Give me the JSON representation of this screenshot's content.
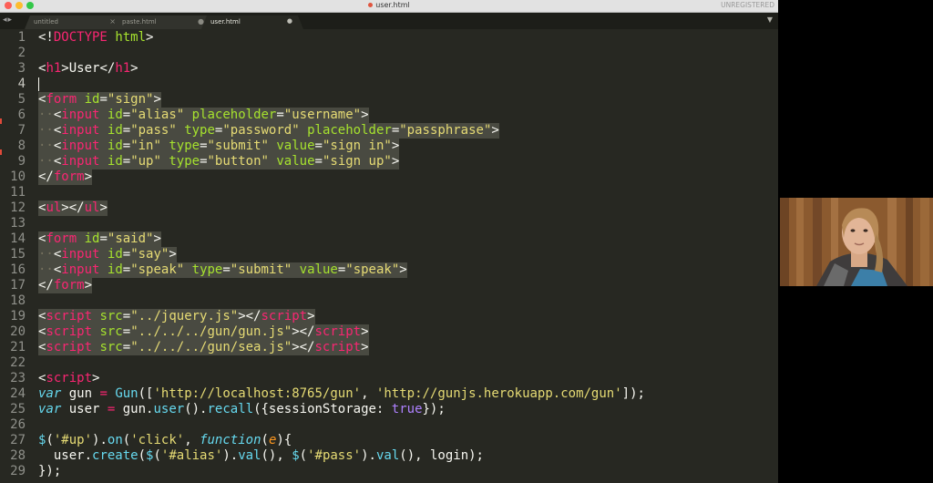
{
  "window": {
    "title": "user.html",
    "unregistered": "UNREGISTERED",
    "dirty_dot_color": "#e0553f"
  },
  "tabs": [
    {
      "label": "untitled",
      "close": "×",
      "active": false
    },
    {
      "label": "paste.html",
      "close": "●",
      "active": false
    },
    {
      "label": "user.html",
      "close": "●",
      "active": true
    }
  ],
  "tab_nav_icons": [
    "chevron-left-icon",
    "chevron-right-icon"
  ],
  "theme": {
    "background": "#272822",
    "tag": "#f92672",
    "attr": "#a6e22e",
    "string": "#e6db74",
    "keyword": "#66d9ef",
    "constant": "#ae81ff",
    "param": "#fd971f"
  },
  "editor": {
    "cursor_line": 4,
    "lines": [
      {
        "n": "1",
        "tokens": [
          {
            "c": "p",
            "t": "<!"
          },
          {
            "c": "t",
            "t": "DOCTYPE"
          },
          {
            "c": "p",
            "t": " "
          },
          {
            "c": "a",
            "t": "html"
          },
          {
            "c": "p",
            "t": ">"
          }
        ]
      },
      {
        "n": "2",
        "tokens": []
      },
      {
        "n": "3",
        "tokens": [
          {
            "c": "p",
            "t": "<"
          },
          {
            "c": "t",
            "t": "h1"
          },
          {
            "c": "p",
            "t": ">User</"
          },
          {
            "c": "t",
            "t": "h1"
          },
          {
            "c": "p",
            "t": ">"
          }
        ]
      },
      {
        "n": "4",
        "tokens": []
      },
      {
        "n": "5",
        "tokens": [
          {
            "c": "p",
            "t": "<"
          },
          {
            "c": "t",
            "t": "form"
          },
          {
            "c": "p",
            "t": " "
          },
          {
            "c": "a",
            "t": "id"
          },
          {
            "c": "p",
            "t": "="
          },
          {
            "c": "s",
            "t": "\"sign\""
          },
          {
            "c": "p",
            "t": ">"
          }
        ]
      },
      {
        "n": "6",
        "tokens": [
          {
            "c": "d",
            "t": "··"
          },
          {
            "c": "p",
            "t": "<"
          },
          {
            "c": "t",
            "t": "input"
          },
          {
            "c": "p",
            "t": " "
          },
          {
            "c": "a",
            "t": "id"
          },
          {
            "c": "p",
            "t": "="
          },
          {
            "c": "s",
            "t": "\"alias\""
          },
          {
            "c": "p",
            "t": " "
          },
          {
            "c": "a",
            "t": "placeholder"
          },
          {
            "c": "p",
            "t": "="
          },
          {
            "c": "s",
            "t": "\"username\""
          },
          {
            "c": "p",
            "t": ">"
          }
        ]
      },
      {
        "n": "7",
        "tokens": [
          {
            "c": "d",
            "t": "··"
          },
          {
            "c": "p",
            "t": "<"
          },
          {
            "c": "t",
            "t": "input"
          },
          {
            "c": "p",
            "t": " "
          },
          {
            "c": "a",
            "t": "id"
          },
          {
            "c": "p",
            "t": "="
          },
          {
            "c": "s",
            "t": "\"pass\""
          },
          {
            "c": "p",
            "t": " "
          },
          {
            "c": "a",
            "t": "type"
          },
          {
            "c": "p",
            "t": "="
          },
          {
            "c": "s",
            "t": "\"password\""
          },
          {
            "c": "p",
            "t": " "
          },
          {
            "c": "a",
            "t": "placeholder"
          },
          {
            "c": "p",
            "t": "="
          },
          {
            "c": "s",
            "t": "\"passphrase\""
          },
          {
            "c": "p",
            "t": ">"
          }
        ]
      },
      {
        "n": "8",
        "tokens": [
          {
            "c": "d",
            "t": "··"
          },
          {
            "c": "p",
            "t": "<"
          },
          {
            "c": "t",
            "t": "input"
          },
          {
            "c": "p",
            "t": " "
          },
          {
            "c": "a",
            "t": "id"
          },
          {
            "c": "p",
            "t": "="
          },
          {
            "c": "s",
            "t": "\"in\""
          },
          {
            "c": "p",
            "t": " "
          },
          {
            "c": "a",
            "t": "type"
          },
          {
            "c": "p",
            "t": "="
          },
          {
            "c": "s",
            "t": "\"submit\""
          },
          {
            "c": "p",
            "t": " "
          },
          {
            "c": "a",
            "t": "value"
          },
          {
            "c": "p",
            "t": "="
          },
          {
            "c": "s",
            "t": "\"sign in\""
          },
          {
            "c": "p",
            "t": ">"
          }
        ]
      },
      {
        "n": "9",
        "tokens": [
          {
            "c": "d",
            "t": "··"
          },
          {
            "c": "p",
            "t": "<"
          },
          {
            "c": "t",
            "t": "input"
          },
          {
            "c": "p",
            "t": " "
          },
          {
            "c": "a",
            "t": "id"
          },
          {
            "c": "p",
            "t": "="
          },
          {
            "c": "s",
            "t": "\"up\""
          },
          {
            "c": "p",
            "t": " "
          },
          {
            "c": "a",
            "t": "type"
          },
          {
            "c": "p",
            "t": "="
          },
          {
            "c": "s",
            "t": "\"button\""
          },
          {
            "c": "p",
            "t": " "
          },
          {
            "c": "a",
            "t": "value"
          },
          {
            "c": "p",
            "t": "="
          },
          {
            "c": "s",
            "t": "\"sign up\""
          },
          {
            "c": "p",
            "t": ">"
          }
        ]
      },
      {
        "n": "10",
        "tokens": [
          {
            "c": "p",
            "t": "</"
          },
          {
            "c": "t",
            "t": "form"
          },
          {
            "c": "p",
            "t": ">"
          }
        ]
      },
      {
        "n": "11",
        "tokens": []
      },
      {
        "n": "12",
        "tokens": [
          {
            "c": "p",
            "t": "<"
          },
          {
            "c": "t",
            "t": "ul"
          },
          {
            "c": "p",
            "t": "></"
          },
          {
            "c": "t",
            "t": "ul"
          },
          {
            "c": "p",
            "t": ">"
          }
        ]
      },
      {
        "n": "13",
        "tokens": []
      },
      {
        "n": "14",
        "tokens": [
          {
            "c": "p",
            "t": "<"
          },
          {
            "c": "t",
            "t": "form"
          },
          {
            "c": "p",
            "t": " "
          },
          {
            "c": "a",
            "t": "id"
          },
          {
            "c": "p",
            "t": "="
          },
          {
            "c": "s",
            "t": "\"said\""
          },
          {
            "c": "p",
            "t": ">"
          }
        ]
      },
      {
        "n": "15",
        "tokens": [
          {
            "c": "d",
            "t": "··"
          },
          {
            "c": "p",
            "t": "<"
          },
          {
            "c": "t",
            "t": "input"
          },
          {
            "c": "p",
            "t": " "
          },
          {
            "c": "a",
            "t": "id"
          },
          {
            "c": "p",
            "t": "="
          },
          {
            "c": "s",
            "t": "\"say\""
          },
          {
            "c": "p",
            "t": ">"
          }
        ]
      },
      {
        "n": "16",
        "tokens": [
          {
            "c": "d",
            "t": "··"
          },
          {
            "c": "p",
            "t": "<"
          },
          {
            "c": "t",
            "t": "input"
          },
          {
            "c": "p",
            "t": " "
          },
          {
            "c": "a",
            "t": "id"
          },
          {
            "c": "p",
            "t": "="
          },
          {
            "c": "s",
            "t": "\"speak\""
          },
          {
            "c": "p",
            "t": " "
          },
          {
            "c": "a",
            "t": "type"
          },
          {
            "c": "p",
            "t": "="
          },
          {
            "c": "s",
            "t": "\"submit\""
          },
          {
            "c": "p",
            "t": " "
          },
          {
            "c": "a",
            "t": "value"
          },
          {
            "c": "p",
            "t": "="
          },
          {
            "c": "s",
            "t": "\"speak\""
          },
          {
            "c": "p",
            "t": ">"
          }
        ]
      },
      {
        "n": "17",
        "tokens": [
          {
            "c": "p",
            "t": "</"
          },
          {
            "c": "t",
            "t": "form"
          },
          {
            "c": "p",
            "t": ">"
          }
        ]
      },
      {
        "n": "18",
        "tokens": []
      },
      {
        "n": "19",
        "tokens": [
          {
            "c": "p",
            "t": "<"
          },
          {
            "c": "t",
            "t": "script"
          },
          {
            "c": "p",
            "t": " "
          },
          {
            "c": "a",
            "t": "src"
          },
          {
            "c": "p",
            "t": "="
          },
          {
            "c": "s",
            "t": "\"../jquery.js\""
          },
          {
            "c": "p",
            "t": "></"
          },
          {
            "c": "t",
            "t": "script"
          },
          {
            "c": "p",
            "t": ">"
          }
        ]
      },
      {
        "n": "20",
        "tokens": [
          {
            "c": "p",
            "t": "<"
          },
          {
            "c": "t",
            "t": "script"
          },
          {
            "c": "p",
            "t": " "
          },
          {
            "c": "a",
            "t": "src"
          },
          {
            "c": "p",
            "t": "="
          },
          {
            "c": "s",
            "t": "\"../../../gun/gun.js\""
          },
          {
            "c": "p",
            "t": "></"
          },
          {
            "c": "t",
            "t": "script"
          },
          {
            "c": "p",
            "t": ">"
          }
        ]
      },
      {
        "n": "21",
        "tokens": [
          {
            "c": "p",
            "t": "<"
          },
          {
            "c": "t",
            "t": "script"
          },
          {
            "c": "p",
            "t": " "
          },
          {
            "c": "a",
            "t": "src"
          },
          {
            "c": "p",
            "t": "="
          },
          {
            "c": "s",
            "t": "\"../../../gun/sea.js\""
          },
          {
            "c": "p",
            "t": "></"
          },
          {
            "c": "t",
            "t": "script"
          },
          {
            "c": "p",
            "t": ">"
          }
        ]
      },
      {
        "n": "22",
        "tokens": []
      },
      {
        "n": "23",
        "tokens": [
          {
            "c": "p",
            "t": "<"
          },
          {
            "c": "t",
            "t": "script"
          },
          {
            "c": "p",
            "t": ">"
          }
        ]
      },
      {
        "n": "24",
        "tokens": [
          {
            "c": "k",
            "t": "var"
          },
          {
            "c": "p",
            "t": " gun "
          },
          {
            "c": "t",
            "t": "="
          },
          {
            "c": "p",
            "t": " "
          },
          {
            "c": "f",
            "t": "Gun"
          },
          {
            "c": "p",
            "t": "(["
          },
          {
            "c": "s",
            "t": "'http://localhost:8765/gun'"
          },
          {
            "c": "p",
            "t": ", "
          },
          {
            "c": "s",
            "t": "'http://gunjs.herokuapp.com/gun'"
          },
          {
            "c": "p",
            "t": "]);"
          }
        ]
      },
      {
        "n": "25",
        "tokens": [
          {
            "c": "k",
            "t": "var"
          },
          {
            "c": "p",
            "t": " user "
          },
          {
            "c": "t",
            "t": "="
          },
          {
            "c": "p",
            "t": " gun."
          },
          {
            "c": "f",
            "t": "user"
          },
          {
            "c": "p",
            "t": "()."
          },
          {
            "c": "f",
            "t": "recall"
          },
          {
            "c": "p",
            "t": "({sessionStorage: "
          },
          {
            "c": "c",
            "t": "true"
          },
          {
            "c": "p",
            "t": "});"
          }
        ]
      },
      {
        "n": "26",
        "tokens": []
      },
      {
        "n": "27",
        "tokens": [
          {
            "c": "f",
            "t": "$"
          },
          {
            "c": "p",
            "t": "("
          },
          {
            "c": "s",
            "t": "'#up'"
          },
          {
            "c": "p",
            "t": ")."
          },
          {
            "c": "f",
            "t": "on"
          },
          {
            "c": "p",
            "t": "("
          },
          {
            "c": "s",
            "t": "'click'"
          },
          {
            "c": "p",
            "t": ", "
          },
          {
            "c": "k",
            "t": "function"
          },
          {
            "c": "p",
            "t": "("
          },
          {
            "c": "pa",
            "t": "e"
          },
          {
            "c": "p",
            "t": "){"
          }
        ]
      },
      {
        "n": "28",
        "tokens": [
          {
            "c": "p",
            "t": "  user."
          },
          {
            "c": "f",
            "t": "create"
          },
          {
            "c": "p",
            "t": "("
          },
          {
            "c": "f",
            "t": "$"
          },
          {
            "c": "p",
            "t": "("
          },
          {
            "c": "s",
            "t": "'#alias'"
          },
          {
            "c": "p",
            "t": ")."
          },
          {
            "c": "f",
            "t": "val"
          },
          {
            "c": "p",
            "t": "(), "
          },
          {
            "c": "f",
            "t": "$"
          },
          {
            "c": "p",
            "t": "("
          },
          {
            "c": "s",
            "t": "'#pass'"
          },
          {
            "c": "p",
            "t": ")."
          },
          {
            "c": "f",
            "t": "val"
          },
          {
            "c": "p",
            "t": "(), login);"
          }
        ]
      },
      {
        "n": "29",
        "tokens": [
          {
            "c": "p",
            "t": "});"
          }
        ]
      }
    ]
  },
  "webcam": {
    "subject": "person-on-webcam"
  }
}
